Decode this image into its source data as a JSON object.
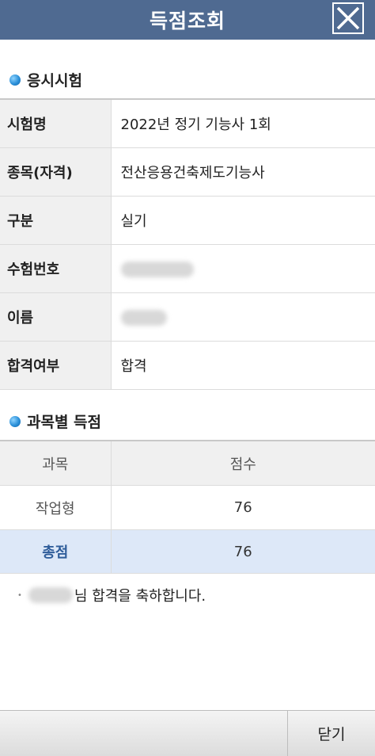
{
  "header": {
    "title": "득점조회"
  },
  "section1": {
    "title": "응시시험"
  },
  "info_rows": [
    {
      "label": "시험명",
      "value": "2022년 정기 기능사 1회"
    },
    {
      "label": "종목(자격)",
      "value": "전산응용건축제도기능사"
    },
    {
      "label": "구분",
      "value": "실기"
    },
    {
      "label": "수험번호",
      "value": ""
    },
    {
      "label": "이름",
      "value": ""
    },
    {
      "label": "합격여부",
      "value": "합격"
    }
  ],
  "section2": {
    "title": "과목별 득점"
  },
  "score_table": {
    "headers": [
      "과목",
      "점수"
    ],
    "rows": [
      {
        "subject": "작업형",
        "score": "76"
      }
    ],
    "total": {
      "label": "총점",
      "score": "76"
    }
  },
  "message": {
    "text": "님 합격을 축하합니다."
  },
  "footer": {
    "close_label": "닫기"
  },
  "colors": {
    "header_bg": "#4f6a91",
    "total_row_bg": "#dde8f8",
    "total_label": "#2f5d9a"
  }
}
